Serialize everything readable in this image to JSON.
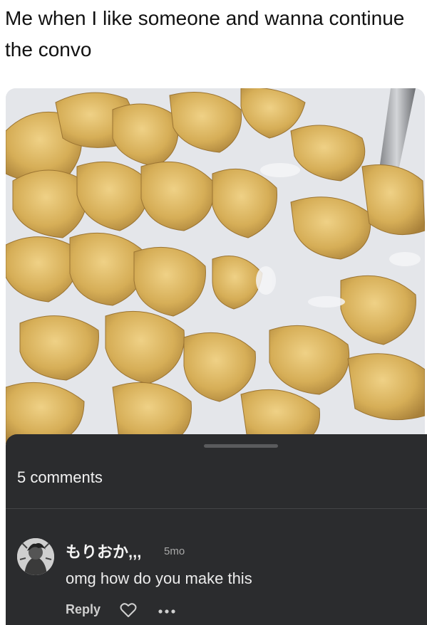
{
  "post": {
    "caption": "Me when I like someone and wanna continue the convo"
  },
  "comments_sheet": {
    "count_label": "5 comments"
  },
  "comment": {
    "username": "もりおか,,,",
    "time": "5mo",
    "text": "omg how do you make this",
    "reply_label": "Reply"
  },
  "icons": {
    "like": "heart-icon",
    "more": "more-dots-icon"
  },
  "colors": {
    "sheet_bg": "#2b2c2e",
    "text_light": "#f2f2f2",
    "milk": "#e9ebee",
    "flake": "#d9b45e"
  }
}
